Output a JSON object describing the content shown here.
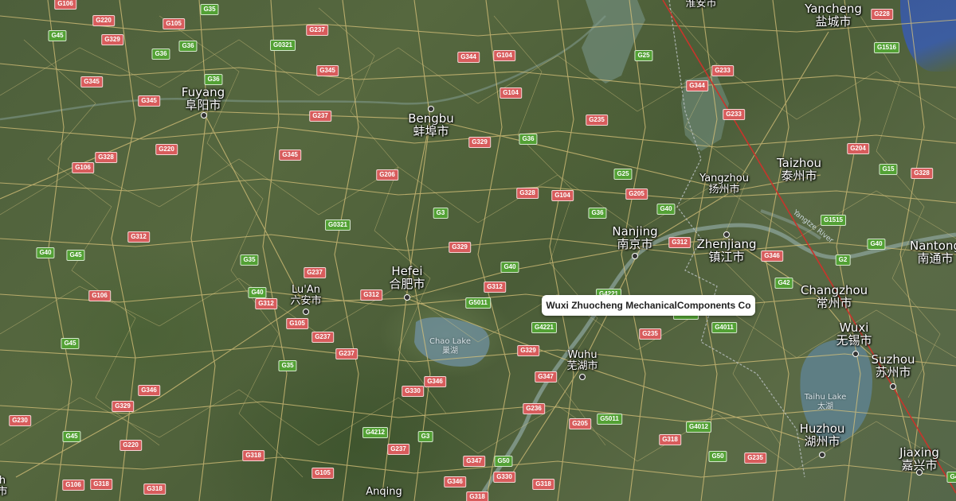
{
  "map": {
    "popup": {
      "label": "Wuxi Zhuocheng MechanicalComponents Co"
    },
    "cities": [
      {
        "en": "Yancheng",
        "zh": "盐城市",
        "id": "yancheng"
      },
      {
        "en": "Fuyang",
        "zh": "阜阳市",
        "id": "fuyang"
      },
      {
        "en": "Bengbu",
        "zh": "蚌埠市",
        "id": "bengbu"
      },
      {
        "en": "Taizhou",
        "zh": "泰州市",
        "id": "taizhou"
      },
      {
        "en": "Yangzhou",
        "zh": "扬州市",
        "id": "yangzhou"
      },
      {
        "en": "Nanjing",
        "zh": "南京市",
        "id": "nanjing"
      },
      {
        "en": "Zhenjiang",
        "zh": "镇江市",
        "id": "zhenjiang"
      },
      {
        "en": "Nantong",
        "zh": "南通市",
        "id": "nantong"
      },
      {
        "en": "Hefei",
        "zh": "合肥市",
        "id": "hefei"
      },
      {
        "en": "Lu'An",
        "zh": "六安市",
        "id": "luan"
      },
      {
        "en": "Changzhou",
        "zh": "常州市",
        "id": "changzhou"
      },
      {
        "en": "Wuxi",
        "zh": "无锡市",
        "id": "wuxi"
      },
      {
        "en": "Wuhu",
        "zh": "芜湖市",
        "id": "wuhu"
      },
      {
        "en": "Suzhou",
        "zh": "苏州市",
        "id": "suzhou"
      },
      {
        "en": "Huzhou",
        "zh": "湖州市",
        "id": "huzhou"
      },
      {
        "en": "Jiaxing",
        "zh": "嘉兴市",
        "id": "jiaxing"
      },
      {
        "en": "Anqing",
        "zh": "",
        "id": "anqing"
      }
    ],
    "partial_labels": {
      "huaian": "淮安市",
      "left_edge": "h",
      "left_edge_zh": "市"
    },
    "lakes": [
      {
        "en": "Chao Lake",
        "zh": "巢湖"
      },
      {
        "en": "Taihu Lake",
        "zh": "太湖"
      }
    ],
    "river_label": "Yangtze River",
    "shields": [
      "G106",
      "G220",
      "G105",
      "G35",
      "G237",
      "G45",
      "G329",
      "G36",
      "G0321",
      "G345",
      "G36",
      "G344",
      "G104",
      "G25",
      "G233",
      "G228",
      "G36",
      "G345",
      "G237",
      "G345",
      "G104",
      "G1516",
      "G235",
      "G233",
      "G344",
      "G220",
      "G106",
      "G328",
      "G345",
      "G206",
      "G329",
      "G36",
      "G204",
      "G15",
      "G328",
      "G25",
      "G205",
      "G328",
      "G104",
      "G3",
      "G36",
      "G40",
      "G0321",
      "G312",
      "G312",
      "G1515",
      "G40",
      "G35",
      "G329",
      "G40",
      "G312",
      "G346",
      "G2",
      "G40",
      "G45",
      "G237",
      "G312",
      "G5011",
      "G4221",
      "G42",
      "G106",
      "G40",
      "G312",
      "G105",
      "G237",
      "G329",
      "G235",
      "G4011",
      "G45",
      "G237",
      "G35",
      "G347",
      "G346",
      "G346",
      "G330",
      "G236",
      "G230",
      "G329",
      "G45",
      "G4212",
      "G3",
      "G205",
      "G5011",
      "G220",
      "G237",
      "G50",
      "G318",
      "G4012",
      "G50",
      "G235",
      "G318",
      "G347",
      "G330",
      "G105",
      "G106",
      "G318",
      "G318",
      "G346",
      "G318",
      "G318",
      "G42",
      "G4221",
      "G4221"
    ]
  }
}
